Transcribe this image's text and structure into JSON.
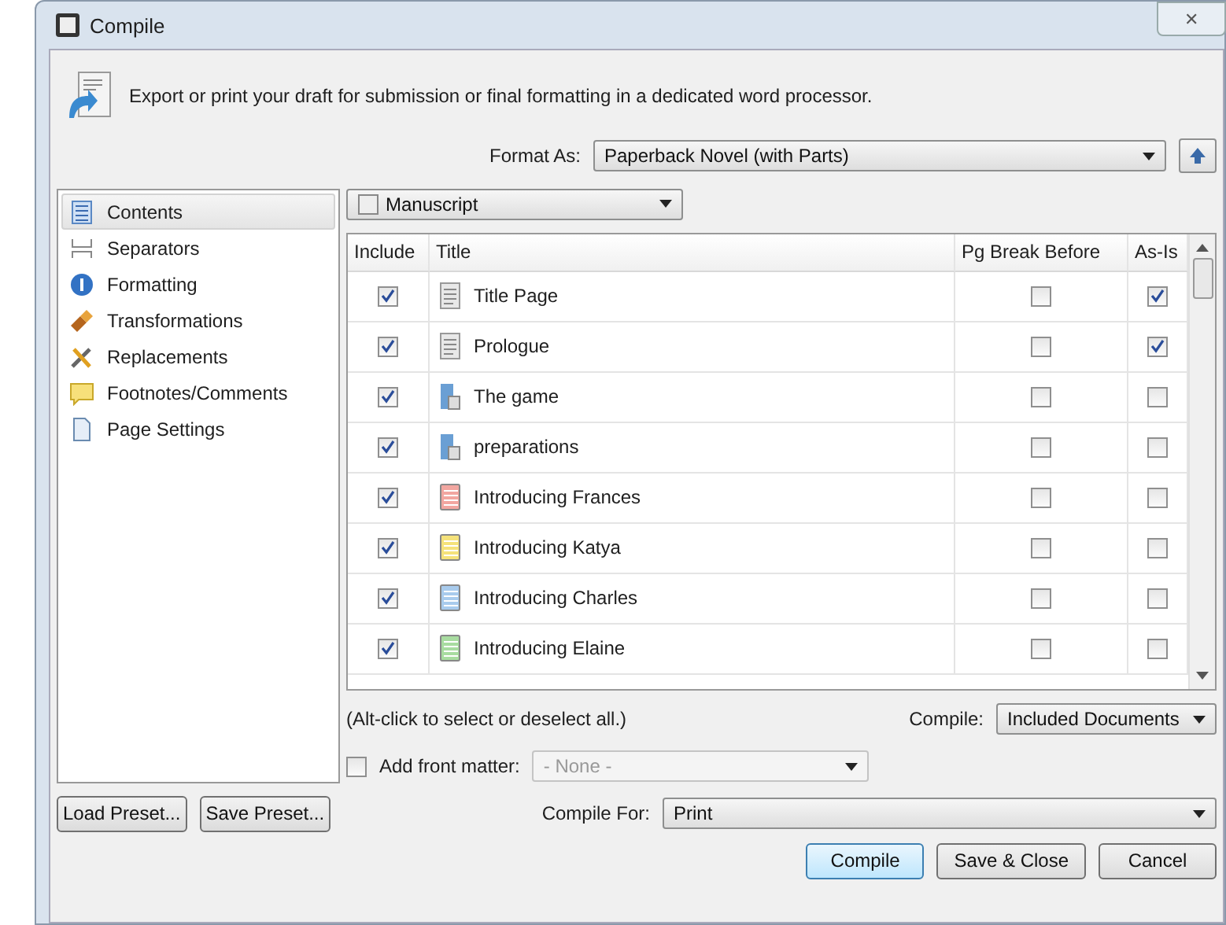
{
  "window": {
    "title": "Compile",
    "close": "✕"
  },
  "description": "Export or print your draft for submission or final formatting in a dedicated word processor.",
  "format_as": {
    "label": "Format As:",
    "value": "Paperback Novel (with Parts)"
  },
  "sidebar": {
    "items": [
      {
        "label": "Contents",
        "selected": true
      },
      {
        "label": "Separators",
        "selected": false
      },
      {
        "label": "Formatting",
        "selected": false
      },
      {
        "label": "Transformations",
        "selected": false
      },
      {
        "label": "Replacements",
        "selected": false
      },
      {
        "label": "Footnotes/Comments",
        "selected": false
      },
      {
        "label": "Page Settings",
        "selected": false
      }
    ]
  },
  "folder_select": {
    "value": "Manuscript"
  },
  "table": {
    "columns": [
      "Include",
      "Title",
      "Pg Break Before",
      "As-Is"
    ],
    "rows": [
      {
        "include": true,
        "title": "Title Page",
        "kind": "document",
        "color": "#e8e8e8",
        "pg_break": false,
        "as_is": true
      },
      {
        "include": true,
        "title": "Prologue",
        "kind": "document",
        "color": "#e8e8e8",
        "pg_break": false,
        "as_is": true
      },
      {
        "include": true,
        "title": "The game",
        "kind": "folder",
        "color": "#6a9fd4",
        "pg_break": false,
        "as_is": false
      },
      {
        "include": true,
        "title": "preparations",
        "kind": "folder",
        "color": "#6a9fd4",
        "pg_break": false,
        "as_is": false
      },
      {
        "include": true,
        "title": "Introducing Frances",
        "kind": "card",
        "color": "#f2a6a0",
        "pg_break": false,
        "as_is": false
      },
      {
        "include": true,
        "title": "Introducing Katya",
        "kind": "card",
        "color": "#f5e27a",
        "pg_break": false,
        "as_is": false
      },
      {
        "include": true,
        "title": "Introducing Charles",
        "kind": "card",
        "color": "#a8cbed",
        "pg_break": false,
        "as_is": false
      },
      {
        "include": true,
        "title": "Introducing Elaine",
        "kind": "card",
        "color": "#a8dca0",
        "pg_break": false,
        "as_is": false
      }
    ]
  },
  "hint": "(Alt-click to select or deselect all.)",
  "compile_select": {
    "label": "Compile:",
    "value": "Included Documents"
  },
  "front_matter": {
    "label": "Add front matter:",
    "checked": false,
    "value": "- None -",
    "disabled": true
  },
  "compile_for": {
    "label": "Compile For:",
    "value": "Print"
  },
  "preset_buttons": [
    "Load Preset...",
    "Save Preset..."
  ],
  "buttons": [
    {
      "label": "Compile",
      "default": true
    },
    {
      "label": "Save & Close",
      "default": false
    },
    {
      "label": "Cancel",
      "default": false
    }
  ]
}
